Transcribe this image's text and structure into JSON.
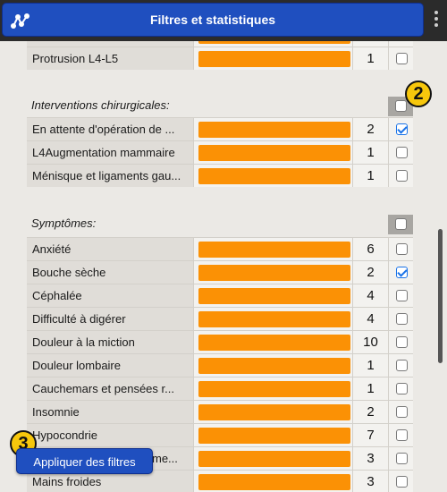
{
  "window": {
    "title": "Filtres et statistiques"
  },
  "colors": {
    "bar": "#fb9105",
    "title_bar": "#1f4fbf",
    "checkbox_checked": "#1a73e8"
  },
  "top_row": {
    "label": "Protrusion L4-L5",
    "count": "1",
    "checked": false
  },
  "sections": [
    {
      "title": "Interventions chirurgicales:",
      "header_checked": false,
      "rows": [
        {
          "label": "En attente d'opération de ...",
          "count": "2",
          "checked": true
        },
        {
          "label": "L4Augmentation mammaire",
          "count": "1",
          "checked": false
        },
        {
          "label": "Ménisque et ligaments gau...",
          "count": "1",
          "checked": false
        }
      ]
    },
    {
      "title": "Symptômes:",
      "header_checked": false,
      "rows": [
        {
          "label": "Anxiété",
          "count": "6",
          "checked": false
        },
        {
          "label": "Bouche sèche",
          "count": "2",
          "checked": true
        },
        {
          "label": "Céphalée",
          "count": "4",
          "checked": false
        },
        {
          "label": "Difficulté à digérer",
          "count": "4",
          "checked": false
        },
        {
          "label": "Douleur à la miction",
          "count": "10",
          "checked": false
        },
        {
          "label": "Douleur lombaire",
          "count": "1",
          "checked": false
        },
        {
          "label": "Cauchemars et pensées r...",
          "count": "1",
          "checked": false
        },
        {
          "label": "Insomnie",
          "count": "2",
          "checked": false
        },
        {
          "label": "Hypocondrie",
          "count": "7",
          "checked": false
        },
        {
          "label": "me...",
          "count": "3",
          "checked": false
        },
        {
          "label": "Mains froides",
          "count": "3",
          "checked": false
        }
      ]
    }
  ],
  "badges": {
    "two": "2",
    "three": "3"
  },
  "apply_button": {
    "label": "Appliquer des filtres"
  },
  "icons": {
    "app": "graph-nodes-icon",
    "menu": "kebab-menu-icon",
    "checkbox": "checkbox-icon"
  }
}
